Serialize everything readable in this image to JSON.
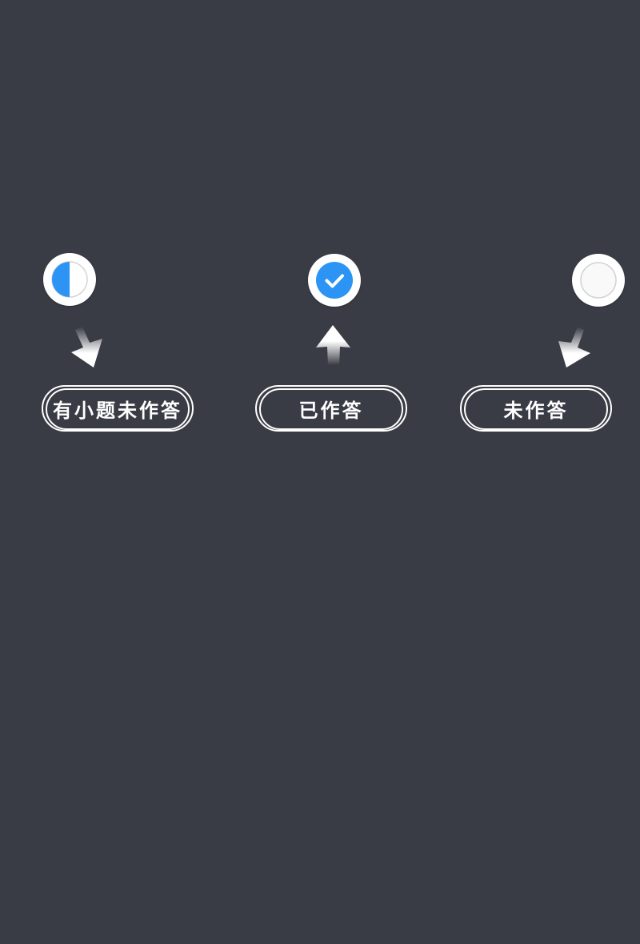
{
  "legend": {
    "items": [
      {
        "icon": "half-filled-circle-icon",
        "label": "有小题未作答"
      },
      {
        "icon": "check-circle-icon",
        "label": "已作答"
      },
      {
        "icon": "empty-circle-icon",
        "label": "未作答"
      }
    ]
  },
  "colors": {
    "background": "#3a3c45",
    "accent": "#2c94f4",
    "ring": "#ffffff",
    "empty_border": "#d0d2d8"
  }
}
